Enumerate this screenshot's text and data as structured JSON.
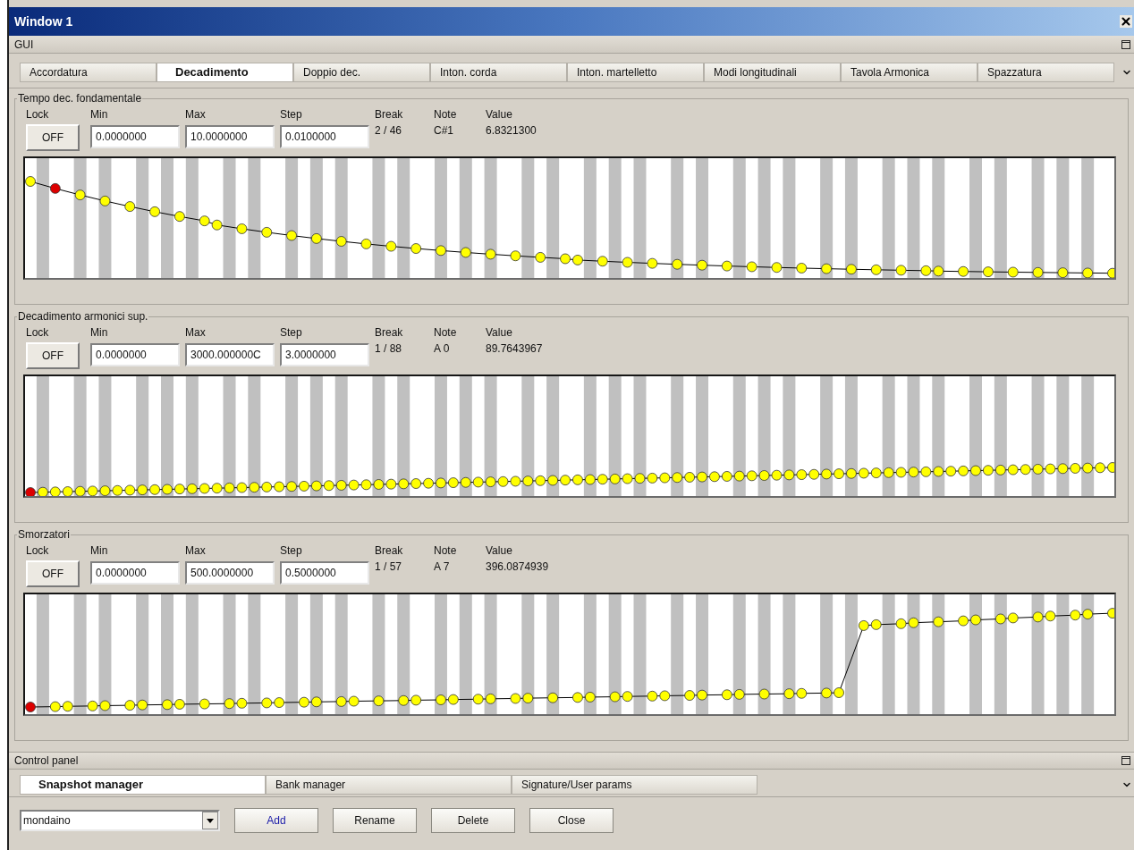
{
  "window": {
    "title": "Window 1"
  },
  "gui": {
    "title": "GUI"
  },
  "tabs": [
    {
      "label": "Accordatura",
      "selected": false
    },
    {
      "label": "Decadimento",
      "selected": true
    },
    {
      "label": "Doppio dec.",
      "selected": false
    },
    {
      "label": "Inton. corda",
      "selected": false
    },
    {
      "label": "Inton. martelletto",
      "selected": false
    },
    {
      "label": "Modi longitudinali",
      "selected": false
    },
    {
      "label": "Tavola Armonica",
      "selected": false
    },
    {
      "label": "Spazzatura",
      "selected": false
    }
  ],
  "panels": [
    {
      "title": "Tempo dec. fondamentale",
      "columns": [
        "Lock",
        "Min",
        "Max",
        "Step",
        "Break",
        "Note",
        "Value"
      ],
      "lock": "OFF",
      "min": "0.0000000",
      "max": "10.0000000",
      "step": "0.0100000",
      "break": "2 / 46",
      "note": "C#1",
      "value": "6.8321300"
    },
    {
      "title": "Decadimento armonici sup.",
      "columns": [
        "Lock",
        "Min",
        "Max",
        "Step",
        "Break",
        "Note",
        "Value"
      ],
      "lock": "OFF",
      "min": "0.0000000",
      "max": "3000.000000C",
      "step": "3.0000000",
      "break": "1 / 88",
      "note": "A 0",
      "value": "89.7643967"
    },
    {
      "title": "Smorzatori",
      "columns": [
        "Lock",
        "Min",
        "Max",
        "Step",
        "Break",
        "Note",
        "Value"
      ],
      "lock": "OFF",
      "min": "0.0000000",
      "max": "500.0000000",
      "step": "0.5000000",
      "break": "1 / 57",
      "note": "A 7",
      "value": "396.0874939"
    }
  ],
  "control_panel": {
    "title": "Control panel",
    "tabs": [
      {
        "label": "Snapshot manager",
        "selected": true
      },
      {
        "label": "Bank manager",
        "selected": false
      },
      {
        "label": "Signature/User params",
        "selected": false
      }
    ],
    "snapshot": "mondaino",
    "buttons": [
      {
        "label": "Add",
        "kind": "default"
      },
      {
        "label": "Rename",
        "kind": "normal"
      },
      {
        "label": "Delete",
        "kind": "normal"
      },
      {
        "label": "Close",
        "kind": "normal"
      }
    ]
  }
}
